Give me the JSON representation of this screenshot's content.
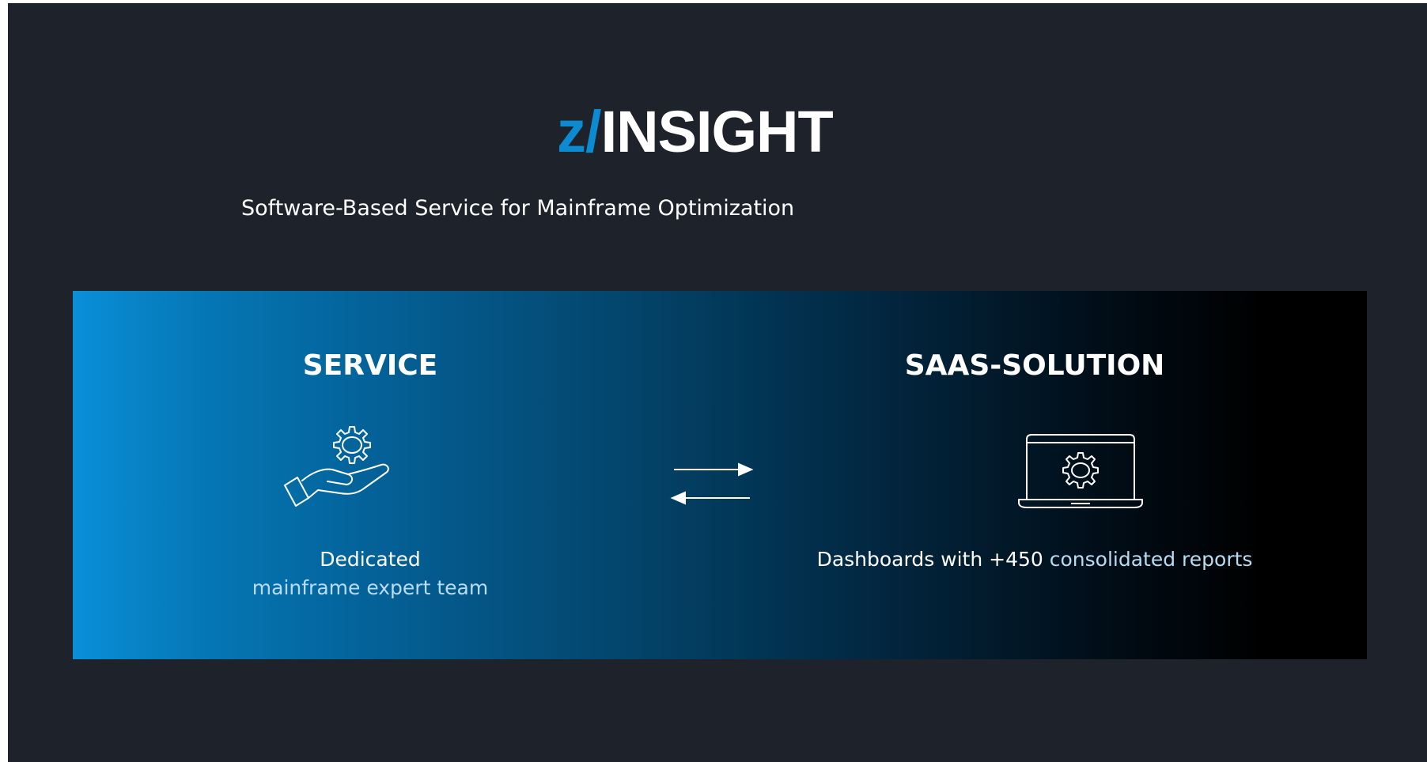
{
  "logo": {
    "prefix": "z/",
    "name": "INSIGHT"
  },
  "subtitle": "Software-Based Service for Mainframe Optimization",
  "panel": {
    "service": {
      "title": "SERVICE",
      "icon": "hand-gear-icon",
      "line1": "Dedicated",
      "line2": "mainframe expert team"
    },
    "exchange_icon": "exchange-arrows-icon",
    "saas": {
      "title": "SAAS-SOLUTION",
      "icon": "laptop-gear-icon",
      "text_plain": "Dashboards with +450 ",
      "text_highlight": "consolidated reports"
    }
  },
  "colors": {
    "background": "#1e222a",
    "accent_blue": "#0d8bd2",
    "highlight_text": "#b9dcf3"
  }
}
